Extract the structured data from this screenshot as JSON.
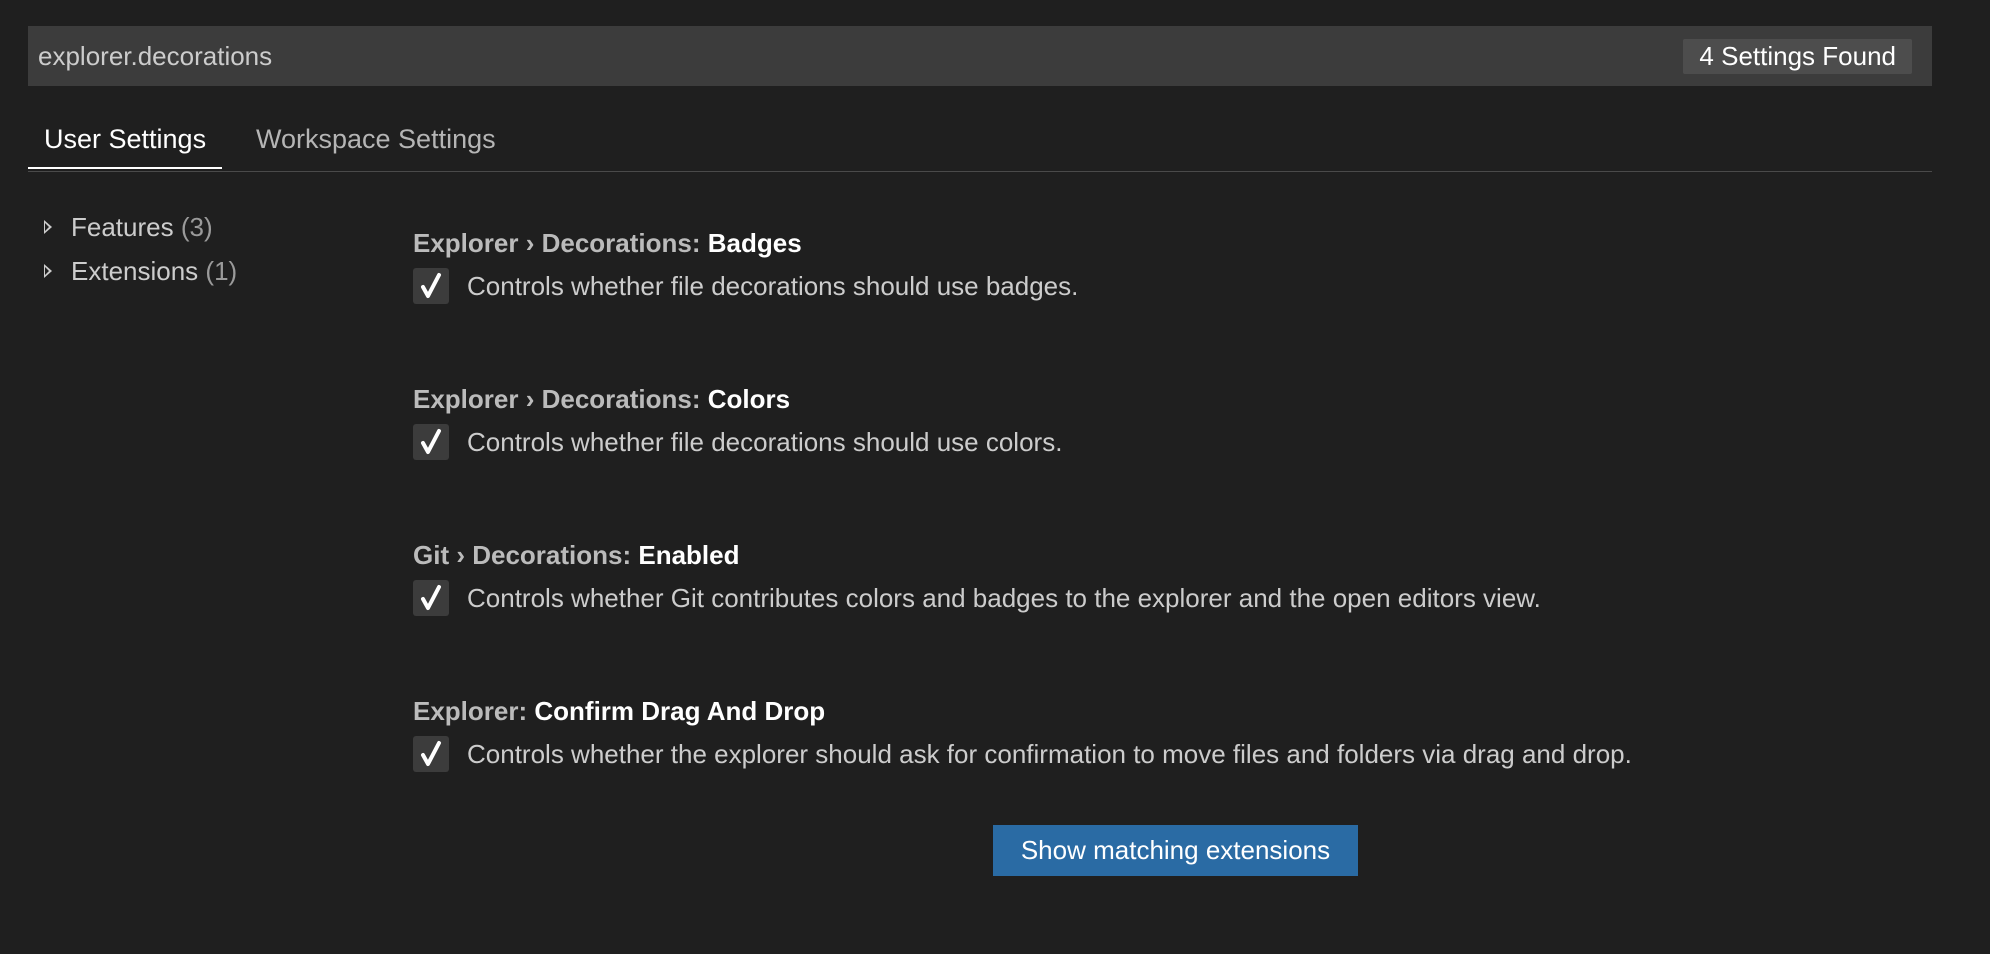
{
  "search": {
    "value": "explorer.decorations",
    "results_count": "4 Settings Found"
  },
  "tabs": [
    {
      "label": "User Settings",
      "active": true
    },
    {
      "label": "Workspace Settings",
      "active": false
    }
  ],
  "tree": {
    "items": [
      {
        "label": "Features",
        "count": "(3)"
      },
      {
        "label": "Extensions",
        "count": "(1)"
      }
    ]
  },
  "settings": [
    {
      "category": "Explorer › Decorations: ",
      "key": "Badges",
      "description": "Controls whether file decorations should use badges.",
      "checked": true
    },
    {
      "category": "Explorer › Decorations: ",
      "key": "Colors",
      "description": "Controls whether file decorations should use colors.",
      "checked": true
    },
    {
      "category": "Git › Decorations: ",
      "key": "Enabled",
      "description": "Controls whether Git contributes colors and badges to the explorer and the open editors view.",
      "checked": true
    },
    {
      "category": "Explorer: ",
      "key": "Confirm Drag And Drop",
      "description": "Controls whether the explorer should ask for confirmation to move files and folders via drag and drop.",
      "checked": true
    }
  ],
  "actions": {
    "show_extensions_label": "Show matching extensions"
  },
  "colors": {
    "background": "#1f1f1f",
    "search_background": "#3c3c3c",
    "button_background": "#2a6ba4",
    "checkbox_background": "#3c3c3c"
  }
}
